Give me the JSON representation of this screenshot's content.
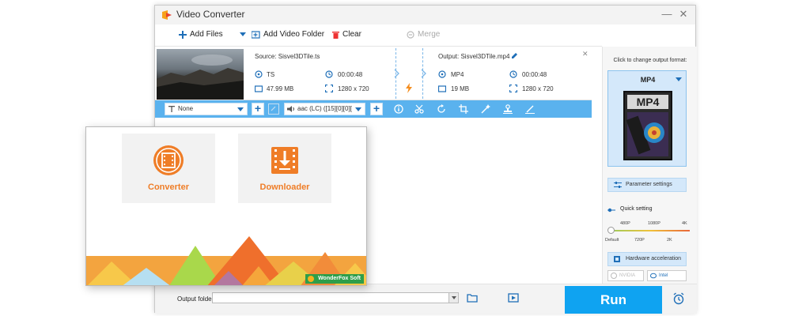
{
  "window": {
    "title": "Video Converter",
    "minimize_glyph": "—",
    "close_glyph": "✕"
  },
  "toolbar": {
    "add_files": "Add Files",
    "add_video_folder": "Add Video Folder",
    "clear": "Clear",
    "merge": "Merge"
  },
  "file": {
    "source_label": "Source: Sisvel3DTile.ts",
    "source_format": "TS",
    "source_duration": "00:00:48",
    "source_size": "47.99 MB",
    "source_resolution": "1280 x 720",
    "output_label": "Output: Sisvel3DTile.mp4",
    "output_format": "MP4",
    "output_duration": "00:00:48",
    "output_size": "19 MB",
    "output_resolution": "1280 x 720",
    "close_glyph": "✕"
  },
  "editbar": {
    "subtitle_value": "None",
    "audio_value": "aac (LC) ([15][0][0][",
    "plus_glyph": "+"
  },
  "right_panel": {
    "hint": "Click to change output format:",
    "format_name": "MP4",
    "format_art_text": "MP4",
    "parameter_settings": "Parameter settings",
    "quick_setting": "Quick setting",
    "ticks_top": [
      "480P",
      "1080P",
      "4K"
    ],
    "ticks_bottom": [
      "Default",
      "720P",
      "2K"
    ],
    "hardware_acceleration": "Hardware acceleration",
    "chip_nvidia": "NVIDIA",
    "chip_intel": "Intel"
  },
  "bottom": {
    "output_folder_label": "Output folder:",
    "output_folder_value": "",
    "run": "Run"
  },
  "launcher": {
    "converter": "Converter",
    "downloader": "Downloader",
    "brand": "WonderFox Soft"
  },
  "colors": {
    "accent": "#0fa3f1",
    "editbar": "#5ab2ee",
    "launcher_orange": "#ef7d27",
    "brand_green": "#2e9e4a"
  }
}
